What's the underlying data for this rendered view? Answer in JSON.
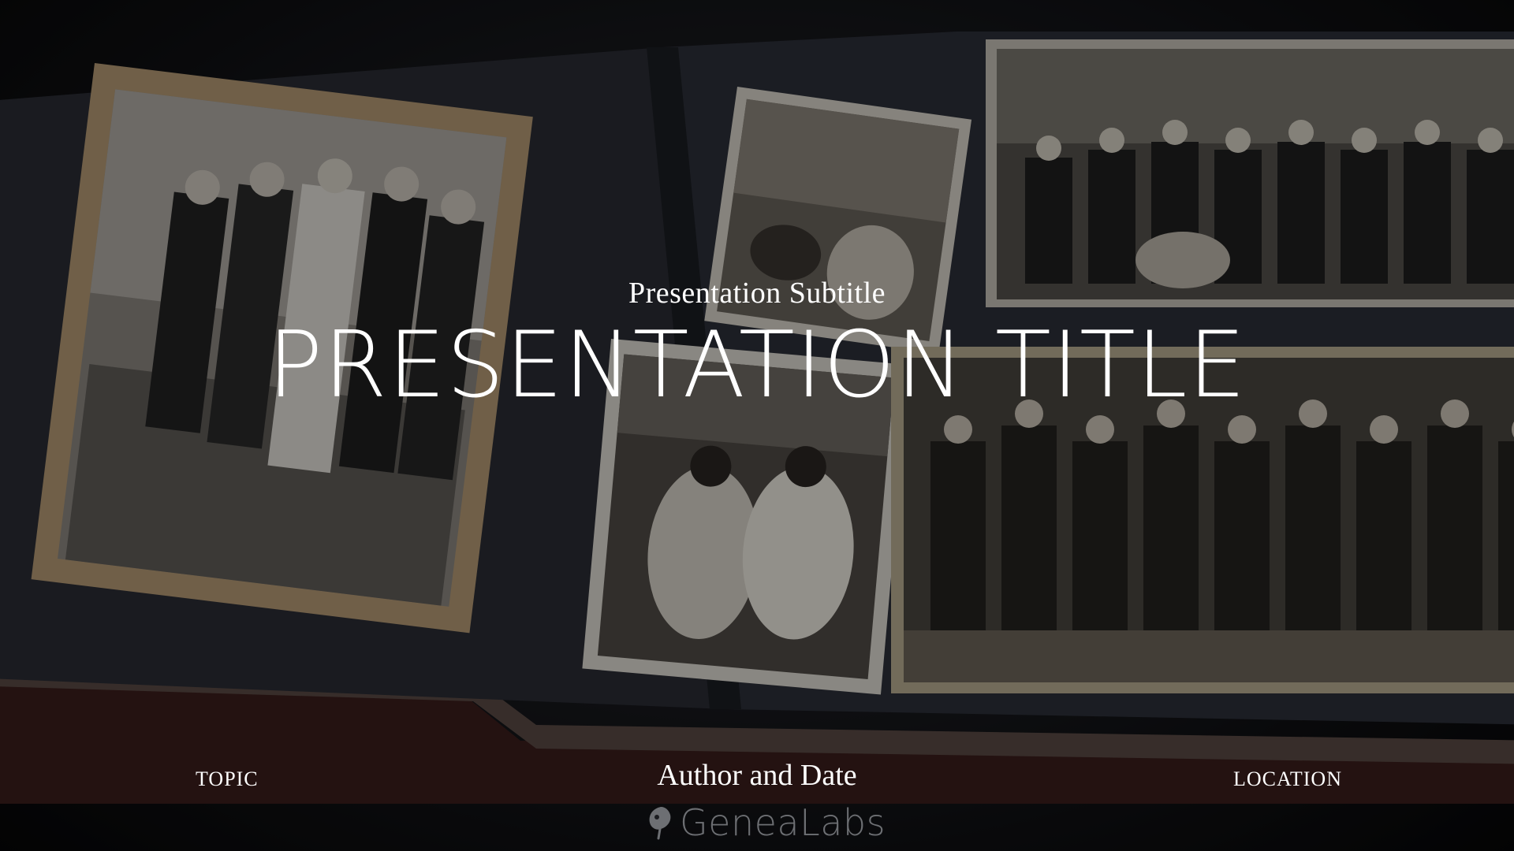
{
  "slide": {
    "subtitle": "Presentation Subtitle",
    "title": "PRESENTATION TITLE",
    "topic": "TOPIC",
    "author_date": "Author and Date",
    "location": "LOCATION",
    "logo_text": "GeneaLabs",
    "logo_icon": "leaf-tree-icon"
  },
  "colors": {
    "text": "#ffffff",
    "logo": "#6d6f73",
    "album_page": "#2b2e36"
  }
}
